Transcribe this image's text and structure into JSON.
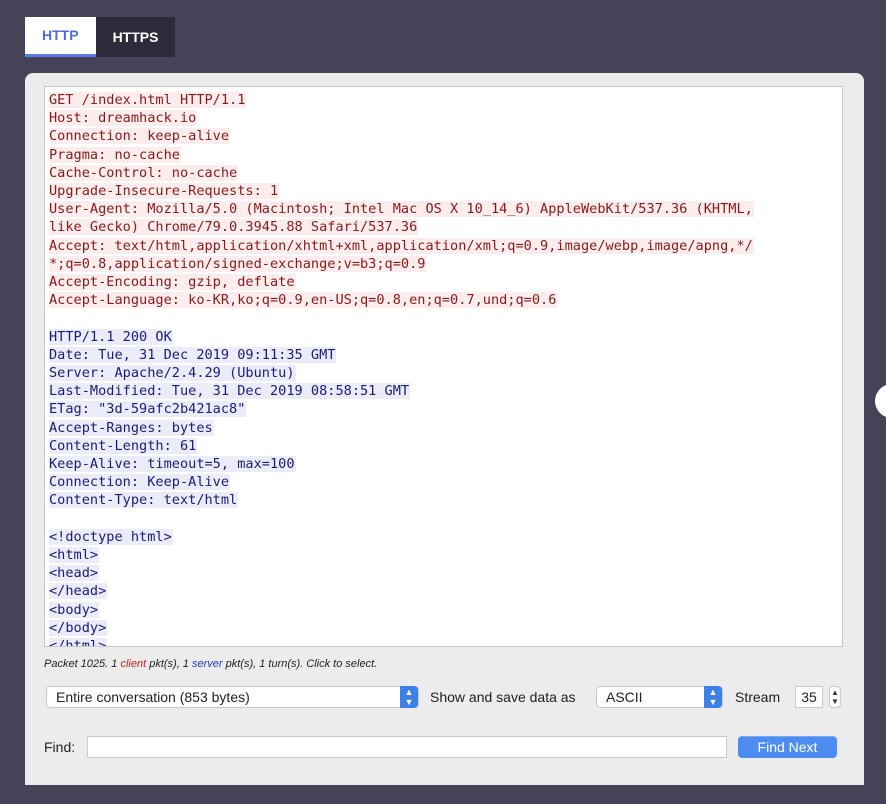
{
  "tabs": [
    {
      "label": "HTTP",
      "active": true
    },
    {
      "label": "HTTPS",
      "active": false
    }
  ],
  "stream": {
    "request_lines": [
      "GET /index.html HTTP/1.1",
      "Host: dreamhack.io",
      "Connection: keep-alive",
      "Pragma: no-cache",
      "Cache-Control: no-cache",
      "Upgrade-Insecure-Requests: 1",
      "User-Agent: Mozilla/5.0 (Macintosh; Intel Mac OS X 10_14_6) AppleWebKit/537.36 (KHTML,",
      "like Gecko) Chrome/79.0.3945.88 Safari/537.36",
      "Accept: text/html,application/xhtml+xml,application/xml;q=0.9,image/webp,image/apng,*/",
      "*;q=0.8,application/signed-exchange;v=b3;q=0.9",
      "Accept-Encoding: gzip, deflate",
      "Accept-Language: ko-KR,ko;q=0.9,en-US;q=0.8,en;q=0.7,und;q=0.6"
    ],
    "response_lines": [
      "HTTP/1.1 200 OK",
      "Date: Tue, 31 Dec 2019 09:11:35 GMT",
      "Server: Apache/2.4.29 (Ubuntu)",
      "Last-Modified: Tue, 31 Dec 2019 08:58:51 GMT",
      "ETag: \"3d-59afc2b421ac8\"",
      "Accept-Ranges: bytes",
      "Content-Length: 61",
      "Keep-Alive: timeout=5, max=100",
      "Connection: Keep-Alive",
      "Content-Type: text/html"
    ],
    "body_lines": [
      "<!doctype html>",
      "<html>",
      "<head>",
      "</head>",
      "<body>",
      "</body>",
      "</html>"
    ]
  },
  "status": {
    "prefix": "Packet 1025. 1 ",
    "client": "client",
    "middle": " pkt(s), 1 ",
    "server": "server",
    "suffix": " pkt(s), 1 turn(s). Click to select."
  },
  "controls": {
    "conversation_select": "Entire conversation (853 bytes)",
    "show_save_label": "Show and save data as",
    "format_select": "ASCII",
    "stream_label": "Stream",
    "stream_number": "35",
    "find_label": "Find:",
    "find_value": "",
    "find_next_label": "Find Next"
  },
  "colors": {
    "background": "#464359",
    "client_text": "#8a1a1a",
    "client_bg": "#fbeded",
    "server_text": "#1b1b7a",
    "server_bg": "#ececf9",
    "accent": "#4d8cf0"
  }
}
